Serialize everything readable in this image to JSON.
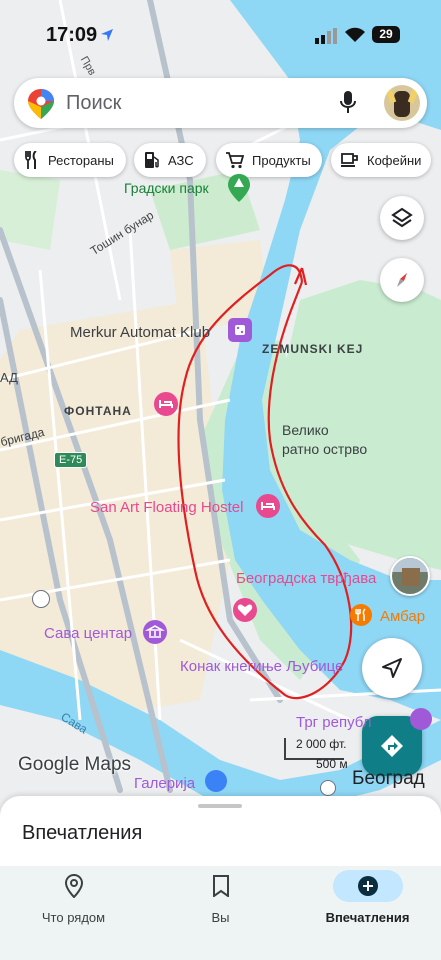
{
  "status_bar": {
    "time": "17:09",
    "battery": "29"
  },
  "search": {
    "placeholder": "Поиск"
  },
  "chips": [
    {
      "label": "Рестораны",
      "icon": "fork-knife-icon"
    },
    {
      "label": "АЗС",
      "icon": "gas-station-icon"
    },
    {
      "label": "Продукты",
      "icon": "cart-icon"
    },
    {
      "label": "Кофейни",
      "icon": "coffee-icon"
    }
  ],
  "map": {
    "labels": {
      "gradski_park": "Градски парк",
      "tosin_bunar": "Тошин бунар",
      "merkur": "Merkur Automat Klub",
      "zemunski_kej": "ZEMUNSKI KEJ",
      "ad": "АД",
      "fontana": "ФОНТАНА",
      "brigada": "бригада",
      "e75": "Е-75",
      "veliko1": "Велико",
      "veliko2": "ратно острво",
      "san_art": "San Art Floating Hostel",
      "tvrdjava": "Београдска тврђава",
      "ambar": "Амбар",
      "sava_centar": "Сава центар",
      "konak": "Конак кнегиње Љубице",
      "sava": "Сава",
      "trg": "Трг републ",
      "galerija": "Галерија",
      "beograd": "Београд",
      "prv": "Прв"
    },
    "scale": {
      "feet": "2 000 фт.",
      "meters": "500 м"
    },
    "watermark": "Google Maps"
  },
  "sheet": {
    "title": "Впечатления"
  },
  "bottom_nav": [
    {
      "label": "Что рядом",
      "icon": "location-pin-icon"
    },
    {
      "label": "Вы",
      "icon": "bookmark-icon"
    },
    {
      "label": "Впечатления",
      "icon": "add-circle-icon",
      "active": true
    }
  ],
  "colors": {
    "water": "#8ed7f5",
    "park": "#c9ecd1",
    "accent_pink": "#e8498f",
    "purple": "#a05ad8",
    "nav_active": "#c2e7ff"
  }
}
